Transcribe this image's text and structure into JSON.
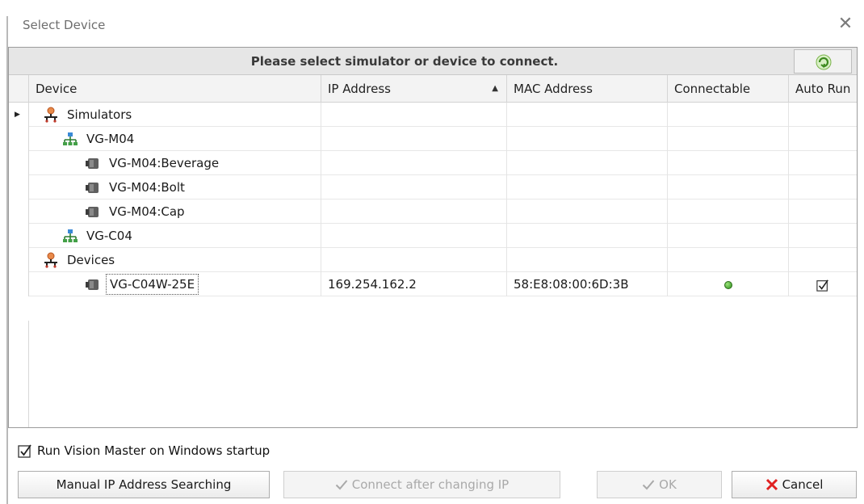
{
  "window": {
    "title": "Select Device"
  },
  "grid": {
    "caption": "Please select simulator or device to connect.",
    "columns": [
      "Device",
      "IP Address",
      "MAC Address",
      "Connectable",
      "Auto Run"
    ],
    "sort_column": "IP Address",
    "sort_direction": "ascending",
    "rows": [
      {
        "name": "Simulators",
        "type": "group",
        "ip": "",
        "mac": "",
        "connectable": false,
        "auto_run": false
      },
      {
        "name": "VG-M04",
        "type": "network",
        "ip": "",
        "mac": "",
        "connectable": false,
        "auto_run": false
      },
      {
        "name": "VG-M04:Beverage",
        "type": "camera",
        "ip": "",
        "mac": "",
        "connectable": false,
        "auto_run": false
      },
      {
        "name": "VG-M04:Bolt",
        "type": "camera",
        "ip": "",
        "mac": "",
        "connectable": false,
        "auto_run": false
      },
      {
        "name": "VG-M04:Cap",
        "type": "camera",
        "ip": "",
        "mac": "",
        "connectable": false,
        "auto_run": false
      },
      {
        "name": "VG-C04",
        "type": "network",
        "ip": "",
        "mac": "",
        "connectable": false,
        "auto_run": false
      },
      {
        "name": "Devices",
        "type": "group",
        "ip": "",
        "mac": "",
        "connectable": false,
        "auto_run": false
      },
      {
        "name": "VG-C04W-25E",
        "type": "camera",
        "ip": "169.254.162.2",
        "mac": "58:E8:08:00:6D:3B",
        "connectable": true,
        "auto_run": true
      }
    ]
  },
  "options": {
    "run_on_startup_label": "Run Vision Master on Windows startup",
    "run_on_startup_checked": true
  },
  "buttons": {
    "manual_search": "Manual IP Address Searching",
    "connect_after_ip": "Connect after changing IP",
    "ok": "OK",
    "cancel": "Cancel"
  },
  "colors": {
    "caption_bg": "#e6e6e6",
    "status_on": "#2f8f1d",
    "cancel_x": "#e02020",
    "disabled_text": "#a9a9a9"
  },
  "icons": {
    "group": "people-network-icon",
    "network": "network-icon",
    "camera": "camera-icon",
    "refresh": "refresh-icon",
    "close": "close-icon"
  }
}
